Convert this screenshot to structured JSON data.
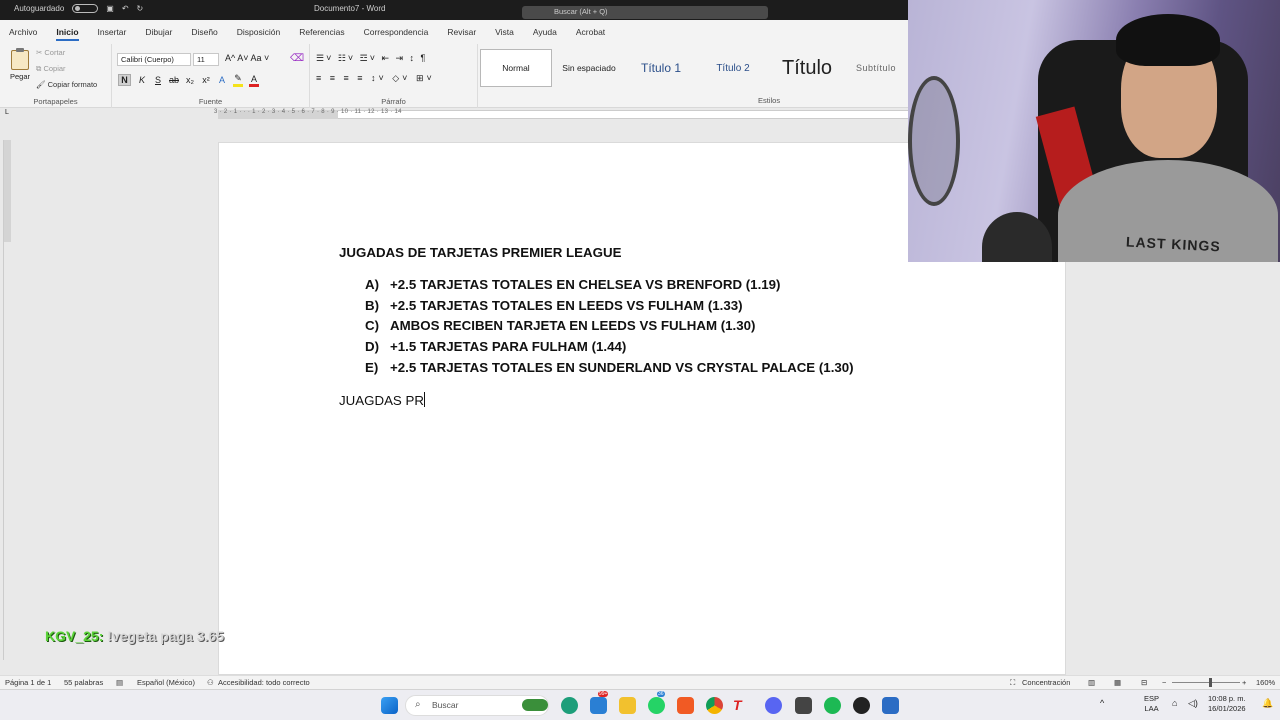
{
  "titlebar": {
    "autosave": "Autoguardado",
    "document": "Documento7 - Word",
    "search": "Buscar (Alt + Q)"
  },
  "menu": {
    "tabs": [
      "Archivo",
      "Inicio",
      "Insertar",
      "Dibujar",
      "Diseño",
      "Disposición",
      "Referencias",
      "Correspondencia",
      "Revisar",
      "Vista",
      "Ayuda",
      "Acrobat"
    ],
    "active": "Inicio"
  },
  "ribbon": {
    "clipboard": {
      "paste": "Pegar",
      "cut": "Cortar",
      "copy": "Copiar",
      "format_painter": "Copiar formato",
      "label": "Portapapeles"
    },
    "font": {
      "name": "Calibri (Cuerpo)",
      "size": "11",
      "label": "Fuente"
    },
    "paragraph": {
      "label": "Párrafo"
    },
    "styles": {
      "label": "Estilos",
      "items": [
        "Normal",
        "Sin espaciado",
        "Título 1",
        "Título 2",
        "Título",
        "Subtítulo"
      ]
    }
  },
  "ruler": {
    "numbers": "3 · 2 · 1 · · · 1 · 2 · 3 · 4 · 5 · 6 · 7 · 8 · 9 · 10 · 11 · 12 · 13 · 14"
  },
  "document": {
    "heading": "JUGADAS DE TARJETAS PREMIER LEAGUE",
    "items": [
      {
        "mark": "A)",
        "text": "+2.5 TARJETAS TOTALES EN CHELSEA VS BRENFORD (1.19)"
      },
      {
        "mark": "B)",
        "text": "+2.5 TARJETAS TOTALES EN LEEDS VS FULHAM (1.33)"
      },
      {
        "mark": "C)",
        "text": "AMBOS RECIBEN TARJETA EN LEEDS VS FULHAM (1.30)"
      },
      {
        "mark": "D)",
        "text": "+1.5 TARJETAS PARA FULHAM (1.44)"
      },
      {
        "mark": "E)",
        "text": "+2.5 TARJETAS TOTALES EN SUNDERLAND VS CRYSTAL PALACE (1.30)"
      }
    ],
    "typing": "JUAGDAS PR"
  },
  "webcam": {
    "shirt_text": "LAST KINGS"
  },
  "chat_overlay": {
    "user": "KGV_25:",
    "message": "!vegeta paga 3.65"
  },
  "statusbar": {
    "page": "Página 1 de 1",
    "words": "55 palabras",
    "language": "Español (México)",
    "accessibility": "Accesibilidad: todo correcto",
    "focus": "Concentración",
    "zoom": "160%"
  },
  "taskbar": {
    "search": "Buscar",
    "lang": "ESP",
    "lang2": "LAA",
    "time": "10:08 p. m.",
    "date": "16/01/2026",
    "badges": {
      "mail": "99+",
      "whatsapp": "36"
    }
  },
  "colors": {
    "word_blue": "#2b6cc4",
    "chat_green": "#5bd339"
  }
}
